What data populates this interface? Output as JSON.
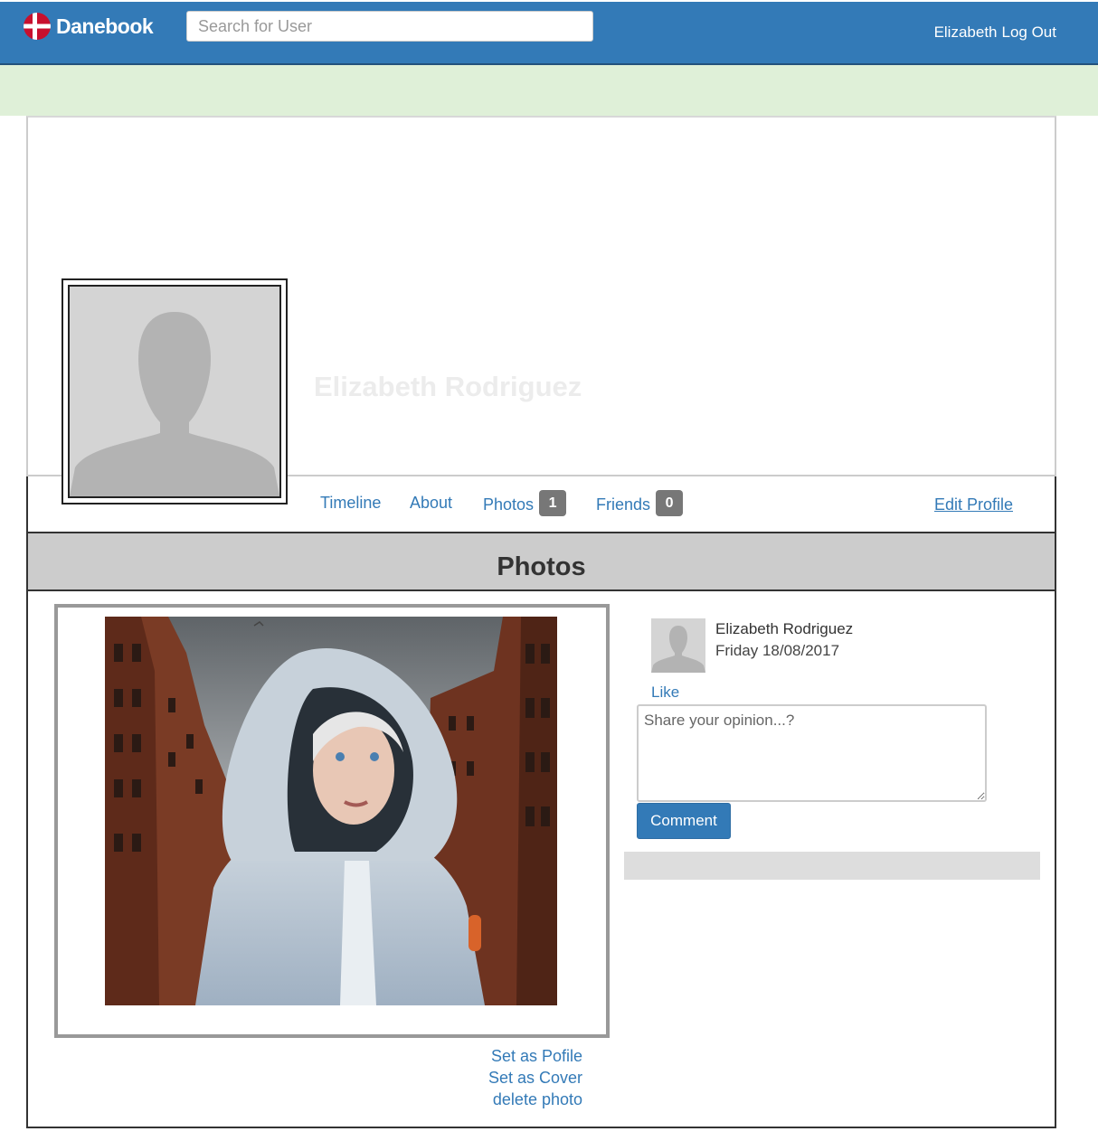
{
  "navbar": {
    "brand": "Danebook",
    "search_placeholder": "Search for User",
    "user_name": "Elizabeth",
    "logout_label": "Log Out",
    "color": "#337ab7"
  },
  "profile": {
    "name": "Elizabeth Rodriguez",
    "nav": {
      "timeline": "Timeline",
      "about": "About",
      "photos": "Photos",
      "photos_count": "1",
      "friends": "Friends",
      "friends_count": "0",
      "edit_profile": "Edit Profile"
    }
  },
  "photos_section": {
    "title": "Photos",
    "actions": {
      "set_profile": "Set as Pofile",
      "set_cover": "Set as Cover",
      "delete": "delete photo"
    }
  },
  "post": {
    "author": "Elizabeth Rodriguez",
    "date": "Friday 18/08/2017",
    "like_label": "Like",
    "comment_placeholder": "Share your opinion...?",
    "comment_button": "Comment"
  },
  "icons": [
    "denmark-flag-icon",
    "avatar-placeholder-icon"
  ]
}
